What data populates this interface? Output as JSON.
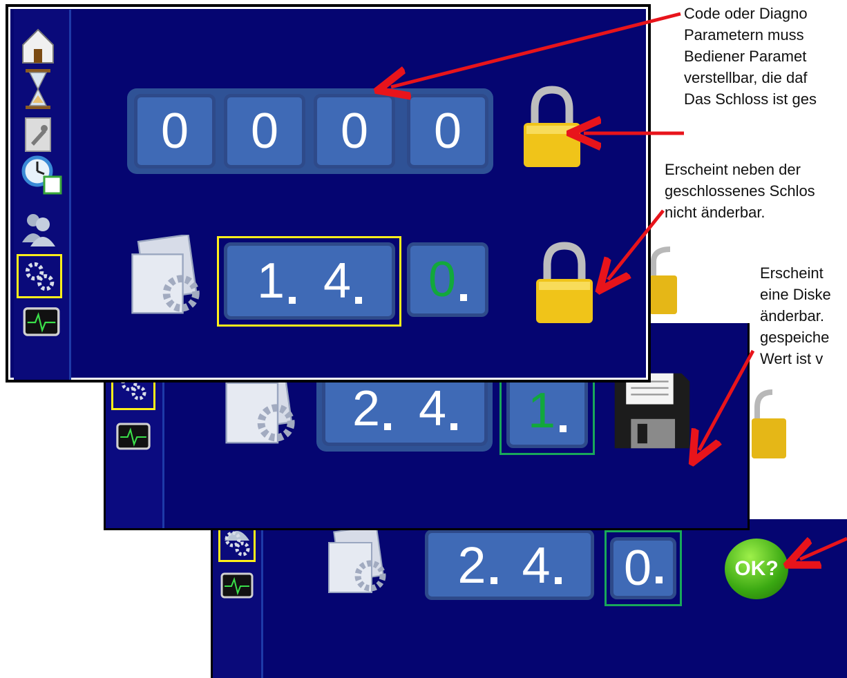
{
  "screen1": {
    "code_digits": [
      "0",
      "0",
      "0",
      "0"
    ],
    "param_group": [
      "1",
      "4"
    ],
    "param_value": "0",
    "status_icons": [
      "lock-icon",
      "lock-icon"
    ]
  },
  "screen2": {
    "param_group": [
      "2",
      "4"
    ],
    "param_value": "1",
    "status_icon": "floppy-disk-icon"
  },
  "screen3": {
    "param_group": [
      "2",
      "4"
    ],
    "param_value": "0",
    "ok_label": "OK?"
  },
  "sidebar_icons": [
    "home-icon",
    "hourglass-icon",
    "wrench-document-icon",
    "clock-calendar-icon",
    "users-icon",
    "gears-icon",
    "monitor-pulse-icon"
  ],
  "annotations": {
    "a1_lines": [
      "Code oder Diagno",
      "Parametern muss",
      "Bediener Paramet",
      "verstellbar, die daf",
      "Das Schloss ist ges"
    ],
    "a2_lines": [
      "Erscheint neben der",
      "geschlossenes Schlos",
      "nicht änderbar."
    ],
    "a3_lines": [
      "Erscheint",
      "eine Diske",
      "änderbar.",
      "gespeiche",
      "Wert ist v"
    ]
  },
  "colors": {
    "panel_bg": "#050571",
    "digit_box": "#3f6ab6",
    "highlight_yellow": "#ffef1a",
    "highlight_green": "#19a85a",
    "value_green": "#12a83c",
    "arrow_red": "#e8141b"
  }
}
